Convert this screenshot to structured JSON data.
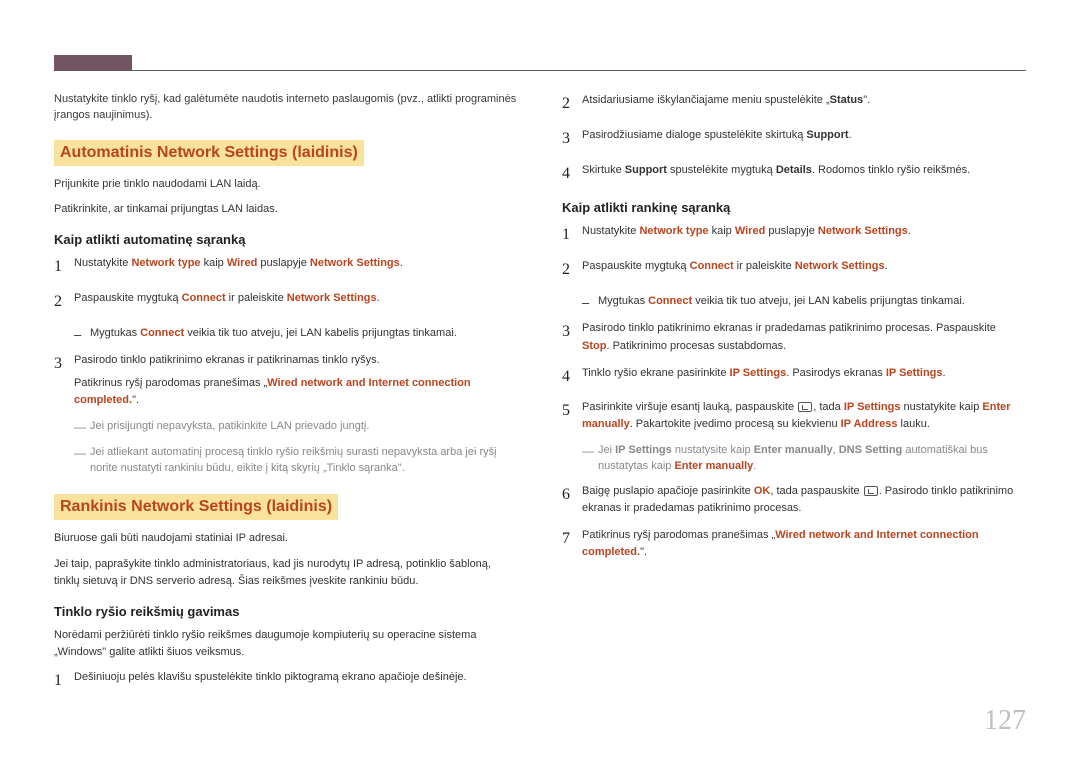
{
  "page_number": "127",
  "left": {
    "intro": "Nustatykite tinklo ryšį, kad galėtumėte naudotis interneto paslaugomis (pvz., atlikti programinės įrangos naujinimus).",
    "section1_title": "Automatinis Network Settings (laidinis)",
    "s1_p1": "Prijunkite prie tinklo naudodami LAN laidą.",
    "s1_p2": "Patikrinkite, ar tinkamai prijungtas LAN laidas.",
    "s1_sub": "Kaip atlikti automatinę sąranką",
    "s1_step1_a": "Nustatykite ",
    "s1_step1_b": " kaip ",
    "s1_step1_c": " puslapyje ",
    "s1_step2_a": "Paspauskite mygtuką ",
    "s1_step2_b": " ir paleiskite ",
    "s1_sub1_a": "Mygtukas ",
    "s1_sub1_b": " veikia tik tuo atveju, jei LAN kabelis prijungtas tinkamai.",
    "s1_step3": "Pasirodo tinklo patikrinimo ekranas ir patikrinamas tinklo ryšys.",
    "s1_step3_conf_a": "Patikrinus ryšį parodomas pranešimas „",
    "s1_step3_conf_b": "\".",
    "s1_note1": "Jei prisijungti nepavyksta, patikinkite LAN prievado jungtį.",
    "s1_note2": "Jei atliekant automatinį procesą tinklo ryšio reikšmių surasti nepavyksta arba jei ryšį norite nustatyti rankiniu būdu, eikite į kitą skyrių „Tinklo sąranka\".",
    "section2_title": "Rankinis Network Settings (laidinis)",
    "s2_p1": "Biuruose gali būti naudojami statiniai IP adresai.",
    "s2_p2": "Jei taip, paprašykite tinklo administratoriaus, kad jis nurodytų IP adresą, potinklio šabloną, tinklų sietuvą ir DNS serverio adresą. Šias reikšmes įveskite rankiniu būdu.",
    "s2_sub": "Tinklo ryšio reikšmių gavimas",
    "s2_p3": "Norėdami peržiūrėti tinklo ryšio reikšmes daugumoje kompiuterių su operacine sistema „Windows\" galite atlikti šiuos veiksmus.",
    "s2_step1": "Dešiniuoju pelės klavišu spustelėkite tinklo piktogramą ekrano apačioje dešinėje."
  },
  "right": {
    "r_step2_a": "Atsidariusiame iškylančiajame meniu spustelėkite „",
    "r_step2_b": "\".",
    "r_step3_a": "Pasirodžiusiame dialoge spustelėkite skirtuką ",
    "r_step4_a": "Skirtuke ",
    "r_step4_b": " spustelėkite mygtuką ",
    "r_step4_c": ". Rodomos tinklo ryšio reikšmės.",
    "r_sub": "Kaip atlikti rankinę sąranką",
    "r_m_step1_a": "Nustatykite ",
    "r_m_step1_b": " kaip ",
    "r_m_step1_c": " puslapyje ",
    "r_m_step2_a": "Paspauskite mygtuką ",
    "r_m_step2_b": " ir paleiskite ",
    "r_m_sub1_a": "Mygtukas ",
    "r_m_sub1_b": " veikia tik tuo atveju, jei LAN kabelis prijungtas tinkamai.",
    "r_m_step3_a": "Pasirodo tinklo patikrinimo ekranas ir pradedamas patikrinimo procesas. Paspauskite ",
    "r_m_step3_b": ". Patikrinimo procesas sustabdomas.",
    "r_m_step4_a": "Tinklo ryšio ekrane pasirinkite ",
    "r_m_step4_b": ". Pasirodys ekranas ",
    "r_m_step5_a": "Pasirinkite viršuje esantį lauką, paspauskite ",
    "r_m_step5_b": ", tada ",
    "r_m_step5_c": " nustatykite kaip ",
    "r_m_step5_d": ". Pakartokite įvedimo procesą su kiekvienu ",
    "r_m_step5_e": " lauku.",
    "r_m_note_a": "Jei ",
    "r_m_note_b": " nustatysite kaip ",
    "r_m_note_c": ", ",
    "r_m_note_d": " automatiškai bus nustatytas kaip ",
    "r_m_step6_a": "Baigę puslapio apačioje pasirinkite ",
    "r_m_step6_b": ", tada paspauskite ",
    "r_m_step6_c": ". Pasirodo tinklo patikrinimo ekranas ir pradedamas patikrinimo procesas.",
    "r_m_step7_a": "Patikrinus ryšį parodomas pranešimas „",
    "r_m_step7_b": "\"."
  },
  "kw": {
    "network_type": "Network type",
    "wired": "Wired",
    "network_settings": "Network Settings",
    "connect": "Connect",
    "completed": "Wired network and Internet connection completed.",
    "status": "Status",
    "support": "Support",
    "details": "Details",
    "stop": "Stop",
    "ip_settings": "IP Settings",
    "enter_manually": "Enter manually",
    "ip_address": "IP Address",
    "ok": "OK",
    "dns_setting": "DNS Setting"
  }
}
